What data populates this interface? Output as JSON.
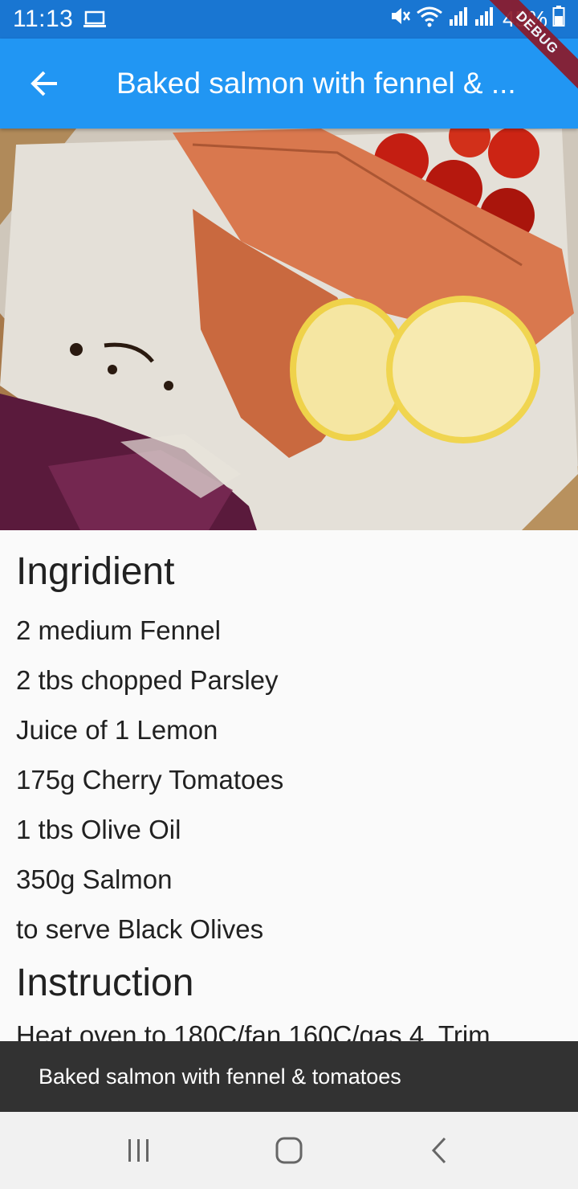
{
  "status_bar": {
    "time": "11:13",
    "battery": "45%",
    "icons": [
      "laptop-icon",
      "mute-icon",
      "wifi-icon",
      "signal-icon",
      "signal-icon",
      "battery-icon"
    ]
  },
  "app_bar": {
    "back_icon": "arrow-back-icon",
    "title": "Baked salmon with fennel & ..."
  },
  "debug_banner": "DEBUG",
  "sections": {
    "ingredients_heading": "Ingridient",
    "ingredients": [
      "2 medium Fennel",
      "2 tbs chopped Parsley",
      "Juice of 1 Lemon",
      "175g Cherry Tomatoes",
      "1 tbs Olive Oil",
      "350g Salmon",
      "to serve Black Olives"
    ],
    "instruction_heading": "Instruction",
    "instruction_text": "Heat oven to 180C/fan 160C/gas 4. Trim"
  },
  "snackbar": {
    "message": "Baked salmon with fennel & tomatoes"
  },
  "nav_bar": {
    "recents_icon": "recents-icon",
    "home_icon": "home-icon",
    "back_icon": "back-chevron-icon"
  },
  "colors": {
    "status_bar": "#1976d2",
    "app_bar": "#2196f3",
    "snackbar": "#323232",
    "nav_bar": "#f1f1f1"
  }
}
